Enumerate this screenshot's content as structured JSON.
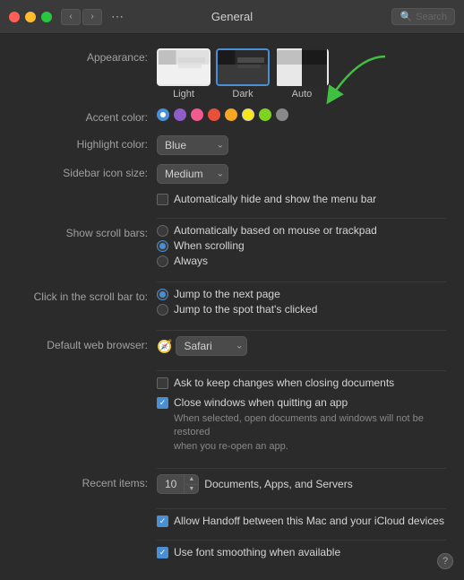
{
  "titlebar": {
    "title": "General",
    "search_placeholder": "Search"
  },
  "appearance": {
    "label": "Appearance:",
    "options": [
      {
        "id": "light",
        "label": "Light",
        "selected": false
      },
      {
        "id": "dark",
        "label": "Dark",
        "selected": true
      },
      {
        "id": "auto",
        "label": "Auto",
        "selected": false
      }
    ]
  },
  "accent_color": {
    "label": "Accent color:",
    "colors": [
      "#4a90d9",
      "#8e5dc7",
      "#f05a8e",
      "#e8503a",
      "#f5a623",
      "#f8e71c",
      "#7ed321",
      "#888888"
    ],
    "selected": 0
  },
  "highlight_color": {
    "label": "Highlight color:",
    "value": "Blue"
  },
  "sidebar_icon_size": {
    "label": "Sidebar icon size:",
    "value": "Medium"
  },
  "menu_bar": {
    "label": "",
    "checkbox_label": "Automatically hide and show the menu bar",
    "checked": false
  },
  "show_scroll_bars": {
    "label": "Show scroll bars:",
    "options": [
      {
        "label": "Automatically based on mouse or trackpad",
        "selected": false
      },
      {
        "label": "When scrolling",
        "selected": true
      },
      {
        "label": "Always",
        "selected": false
      }
    ]
  },
  "click_scroll_bar": {
    "label": "Click in the scroll bar to:",
    "options": [
      {
        "label": "Jump to the next page",
        "selected": true
      },
      {
        "label": "Jump to the spot that's clicked",
        "selected": false
      }
    ]
  },
  "default_browser": {
    "label": "Default web browser:",
    "value": "Safari"
  },
  "ask_keep_changes": {
    "label": "Ask to keep changes when closing documents",
    "checked": false
  },
  "close_windows": {
    "label": "Close windows when quitting an app",
    "checked": true,
    "sub_text": "When selected, open documents and windows will not be restored\nwhen you re-open an app."
  },
  "recent_items": {
    "label": "Recent items:",
    "value": "10",
    "suffix": "Documents, Apps, and Servers"
  },
  "handoff": {
    "label": "Allow Handoff between this Mac and your iCloud devices",
    "checked": true
  },
  "font_smoothing": {
    "label": "Use font smoothing when available",
    "checked": true
  },
  "help_button": "?"
}
